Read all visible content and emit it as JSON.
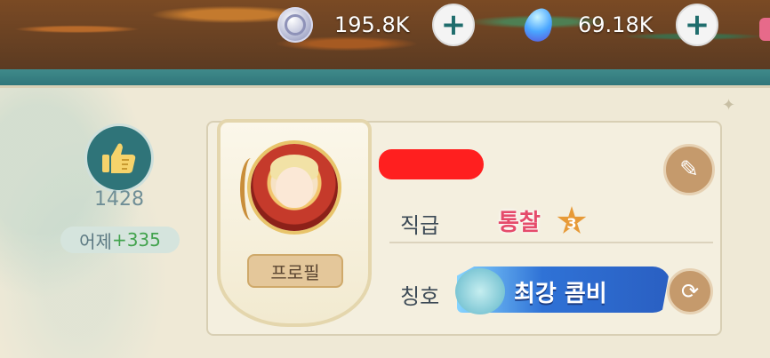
{
  "currencies": [
    {
      "icon": "silver-coin-icon",
      "value": "195.8K",
      "plus_label": "+"
    },
    {
      "icon": "blue-gem-icon",
      "value": "69.18K",
      "plus_label": "+"
    }
  ],
  "likes": {
    "icon": "thumbs-up-icon",
    "count": "1428",
    "yesterday_label": "어제",
    "yesterday_delta": "+335"
  },
  "profile": {
    "button_label": "프로필",
    "rank_label": "직급",
    "rank_value": "통찰",
    "rank_level": "3",
    "title_label": "칭호",
    "title_value": "최강 콤비",
    "edit_icon": "feather-quill-icon",
    "change_icon": "refresh-circle-icon"
  },
  "colors": {
    "teal": "#2f7479",
    "rank_pink": "#e54b6b",
    "delta_green": "#43a34e",
    "redaction": "#ff1f1f"
  }
}
